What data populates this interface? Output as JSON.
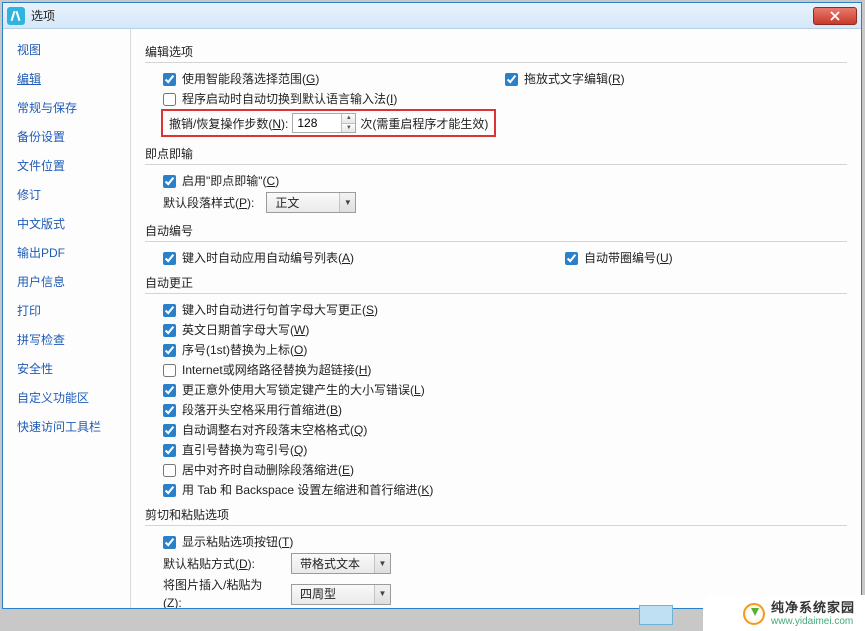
{
  "title": "选项",
  "sidebar": {
    "items": [
      {
        "label": "视图"
      },
      {
        "label": "编辑"
      },
      {
        "label": "常规与保存"
      },
      {
        "label": "备份设置"
      },
      {
        "label": "文件位置"
      },
      {
        "label": "修订"
      },
      {
        "label": "中文版式"
      },
      {
        "label": "输出PDF"
      },
      {
        "label": "用户信息"
      },
      {
        "label": "打印"
      },
      {
        "label": "拼写检查"
      },
      {
        "label": "安全性"
      },
      {
        "label": "自定义功能区"
      },
      {
        "label": "快速访问工具栏"
      }
    ],
    "active_index": 1
  },
  "groups": {
    "edit": {
      "title": "编辑选项",
      "smart_para": {
        "label": "使用智能段落选择范围(",
        "sc": "G",
        "tail": ")"
      },
      "drag_edit": {
        "label": "拖放式文字编辑(",
        "sc": "R",
        "tail": ")"
      },
      "auto_ime": {
        "label": "程序启动时自动切换到默认语言输入法(",
        "sc": "I",
        "tail": ")"
      },
      "undo": {
        "label": "撤销/恢复操作步数(",
        "sc": "N",
        "tail": "):",
        "value": "128",
        "suffix": "次(需重启程序才能生效)"
      }
    },
    "click_type": {
      "title": "即点即输",
      "enable": {
        "label": "启用\"即点即输\"(",
        "sc": "C",
        "tail": ")"
      },
      "style_label": "默认段落样式(",
      "style_sc": "P",
      "style_tail": "):",
      "style_value": "正文"
    },
    "auto_num": {
      "title": "自动编号",
      "list": {
        "label": "键入时自动应用自动编号列表(",
        "sc": "A",
        "tail": ")"
      },
      "circle": {
        "label": "自动带圈编号(",
        "sc": "U",
        "tail": ")"
      }
    },
    "auto_correct": {
      "title": "自动更正",
      "items": [
        {
          "checked": true,
          "label": "键入时自动进行句首字母大写更正(",
          "sc": "S",
          "tail": ")"
        },
        {
          "checked": true,
          "label": "英文日期首字母大写(",
          "sc": "W",
          "tail": ")"
        },
        {
          "checked": true,
          "label": "序号(1st)替换为上标(",
          "sc": "O",
          "tail": ")"
        },
        {
          "checked": false,
          "label": "Internet或网络路径替换为超链接(",
          "sc": "H",
          "tail": ")"
        },
        {
          "checked": true,
          "label": "更正意外使用大写锁定键产生的大小写错误(",
          "sc": "L",
          "tail": ")"
        },
        {
          "checked": true,
          "label": "段落开头空格采用行首缩进(",
          "sc": "B",
          "tail": ")"
        },
        {
          "checked": true,
          "label": "自动调整右对齐段落末空格格式(",
          "sc": "Q",
          "tail": ")"
        },
        {
          "checked": true,
          "label": "直引号替换为弯引号(",
          "sc": "Q",
          "tail": ")"
        },
        {
          "checked": false,
          "label": "居中对齐时自动删除段落缩进(",
          "sc": "E",
          "tail": ")"
        },
        {
          "checked": true,
          "label": "用 Tab 和 Backspace 设置左缩进和首行缩进(",
          "sc": "K",
          "tail": ")"
        }
      ]
    },
    "cut_paste": {
      "title": "剪切和粘贴选项",
      "show_btn": {
        "label": "显示粘贴选项按钮(",
        "sc": "T",
        "tail": ")"
      },
      "default_paste_label": "默认粘贴方式(",
      "default_paste_sc": "D",
      "default_paste_tail": "):",
      "default_paste_value": "带格式文本",
      "insert_pic_label": "将图片插入/粘贴为(",
      "insert_pic_sc": "Z",
      "insert_pic_tail": "):",
      "insert_pic_value": "四周型"
    }
  },
  "watermark": {
    "line1": "纯净系统家园",
    "line2": "www.yidaimei.com"
  }
}
